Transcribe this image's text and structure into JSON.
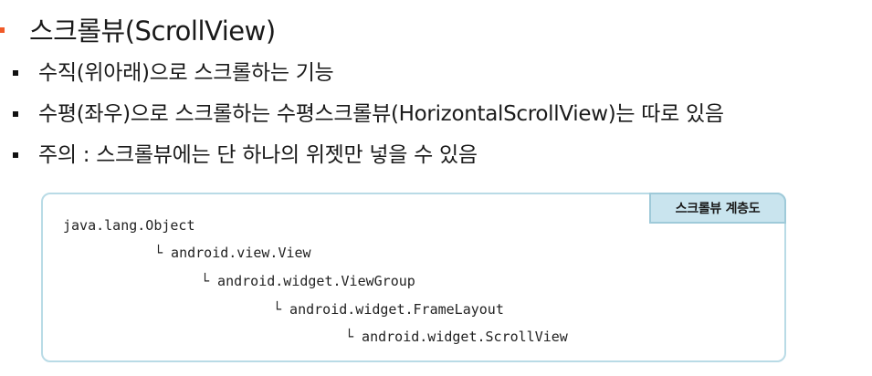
{
  "slide": {
    "title": "스크롤뷰(ScrollView)",
    "bullets": [
      "수직(위아래)으로 스크롤하는 기능",
      "수평(좌우)으로 스크롤하는 수평스크롤뷰(HorizontalScrollView)는 따로 있음",
      "주의 : 스크롤뷰에는 단 하나의 위젯만 넣을 수 있음"
    ]
  },
  "hierarchy_box": {
    "tab_label": "스크롤뷰 계층도",
    "lines": [
      "java.lang.Object",
      "└ android.view.View",
      "└ android.widget.ViewGroup",
      "└ android.widget.FrameLayout",
      "└ android.widget.ScrollView"
    ]
  },
  "colors": {
    "title_marker": "#f05a28",
    "box_border": "#b9dbe6",
    "tab_background": "#c9e4ee"
  }
}
